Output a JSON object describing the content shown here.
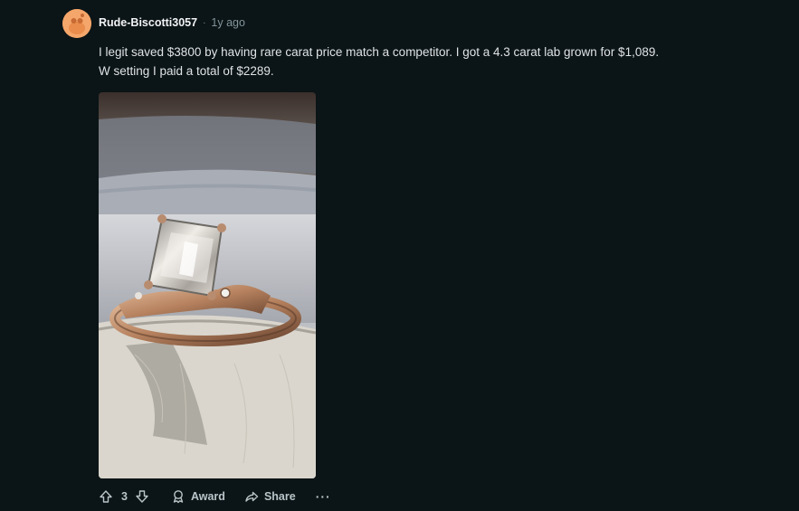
{
  "comment": {
    "author": "Rude-Biscotti3057",
    "separator": "·",
    "time": "1y ago",
    "body_lines": [
      "I legit saved $3800 by having rare carat price match a competitor. I got a 4.3 carat lab grown for $1,089.",
      "W setting I paid a total of $2289."
    ],
    "media_icon": "ring-photo"
  },
  "actions": {
    "upvote_icon": "arrow-up-icon",
    "score": "3",
    "downvote_icon": "arrow-down-icon",
    "award_label": "Award",
    "award_icon": "award-icon",
    "share_label": "Share",
    "share_icon": "share-icon",
    "more_label": "···"
  },
  "colors": {
    "background": "#0b1416",
    "avatar": "#f5a66a",
    "text": "#dfe3e6",
    "muted": "#82959b"
  }
}
